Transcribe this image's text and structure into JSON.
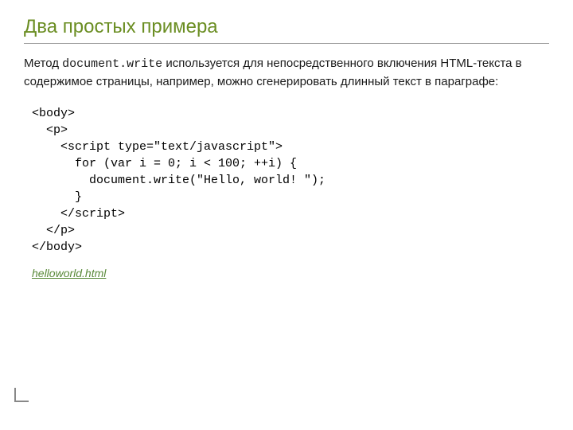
{
  "title": "Два простых примера",
  "para_pre": "Метод ",
  "para_code": "document.write",
  "para_post": " используется для непосредственного включения HTML-текста в содержимое страницы, например, можно сгенерировать длинный текст в параграфе:",
  "code": "<body>\n  <p>\n    <script type=\"text/javascript\">\n      for (var i = 0; i < 100; ++i) {\n        document.write(\"Hello, world! \");\n      }\n    </script>\n  </p>\n</body>",
  "link": "helloworld.html"
}
